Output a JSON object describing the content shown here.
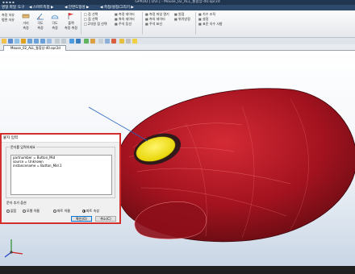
{
  "window": {
    "title": "GPRUD | D\\n | - Mouse_02_ALL_통합상-40.opr2d",
    "qat": "▪ ▪ ▪ ▪"
  },
  "menu": [
    "명형 파일",
    "도구",
    "◀ 스마트측정 ▶",
    "◀ 단면도형성 ▶",
    "◀ 측정/설정/그리기 ▶"
  ],
  "ribbon": {
    "col1": [
      "측정 하유",
      "평면 자유"
    ],
    "big_buttons": [
      "거리\n측정",
      "각도\n측정",
      "각도\n측정",
      "플랙\n측정 측정"
    ],
    "col3": [
      "□ 점 선택",
      "□ 점 선택",
      "□ 2차원 점 선택"
    ],
    "col4": [
      "▦ 측정 데이터",
      "▦ 축의 데이터",
      "▦ 주석 등선"
    ],
    "col5": [
      "▦ 측정 파일 열기",
      "▦ 측의 데이터",
      "▦ 주석 표선"
    ],
    "col6": [
      "▦ 원점",
      "▦ 위치방정"
    ],
    "col7": [
      "▦ 치수 조직",
      "▦ 설정",
      "▦ 표준 치수 사항"
    ]
  },
  "document_tab": {
    "label": "Mouse_02_ALL_통합상-40.opr2d"
  },
  "annotation_3d": {
    "line1": "partnumber = Button_Mid",
    "line2": "source = Unknown",
    "line3": "instancename = Button_Mid.1"
  },
  "dialog": {
    "title": "문자 입력",
    "close": "×",
    "input_group_label": "문자를 입력하세요",
    "text_value": "partnumber = Button_Mid\nsource = Unknown\ninstancename = Button_Mid.1",
    "options_group_label": "문자 추가 옵션",
    "options": [
      {
        "label": "없음",
        "selected": false
      },
      {
        "label": "모델 이름",
        "selected": false
      },
      {
        "label": "파트 이름",
        "selected": false
      },
      {
        "label": "파트 속성",
        "selected": true
      }
    ],
    "ok": "확인(O)",
    "cancel": "취소(C)"
  },
  "colors": {
    "accent_red": "#d32f2f",
    "model_red": "#a3131f",
    "button_yellow": "#f0e60a",
    "titlebar": "#1f3550"
  }
}
